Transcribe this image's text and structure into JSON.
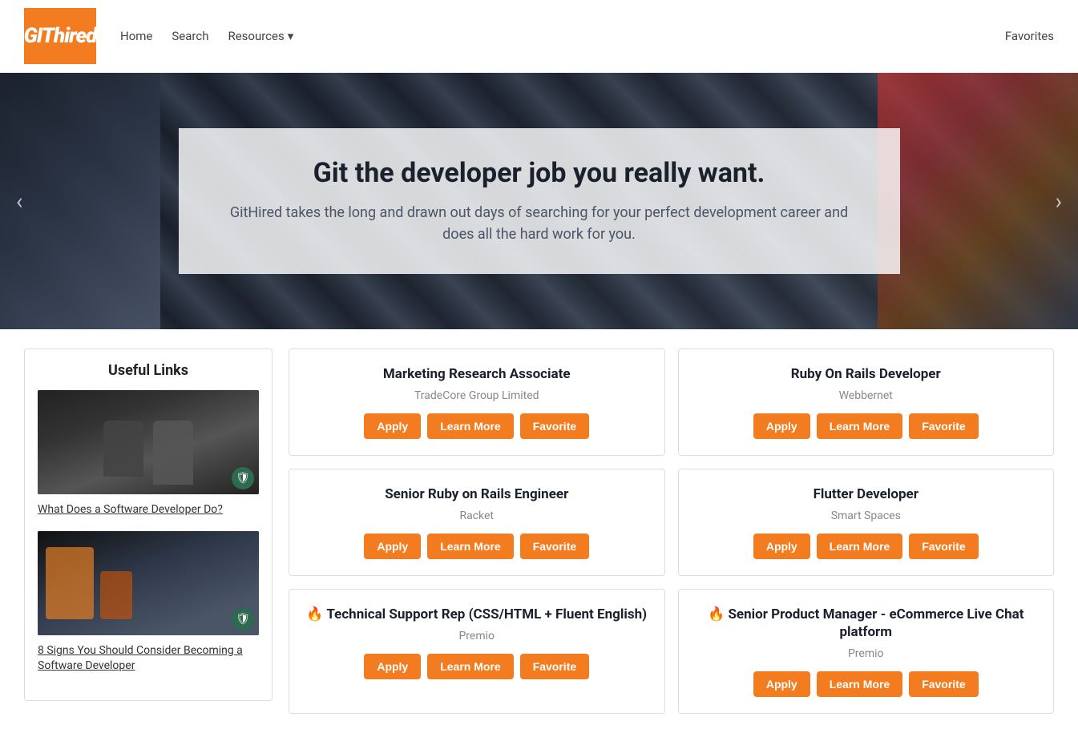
{
  "brand": {
    "logo_git": "GIT",
    "logo_hired": "hired",
    "full_name": "GITHired"
  },
  "navbar": {
    "home_label": "Home",
    "search_label": "Search",
    "resources_label": "Resources",
    "resources_arrow": "▾",
    "favorites_label": "Favorites"
  },
  "hero": {
    "title": "Git the developer job you really want.",
    "subtitle": "GitHired takes the long and drawn out days of searching for your perfect development career and does all the hard work for you.",
    "prev_arrow": "‹",
    "next_arrow": "›"
  },
  "sidebar": {
    "title": "Useful Links",
    "items": [
      {
        "image_alt": "Developer at work",
        "badge": "🛡",
        "link_text": "What Does a Software Developer Do?"
      },
      {
        "image_alt": "Coder at monitor",
        "badge": "🛡",
        "link_text": "8 Signs You Should Consider Becoming a Software Developer"
      }
    ]
  },
  "jobs": [
    {
      "id": 1,
      "title": "Marketing Research Associate",
      "company": "TradeCore Group Limited",
      "hot": false,
      "apply_label": "Apply",
      "learn_more_label": "Learn More",
      "favorite_label": "Favorite"
    },
    {
      "id": 2,
      "title": "Ruby On Rails Developer",
      "company": "Webbernet",
      "hot": false,
      "apply_label": "Apply",
      "learn_more_label": "Learn More",
      "favorite_label": "Favorite"
    },
    {
      "id": 3,
      "title": "Senior Ruby on Rails Engineer",
      "company": "Racket",
      "hot": false,
      "apply_label": "Apply",
      "learn_more_label": "Learn More",
      "favorite_label": "Favorite"
    },
    {
      "id": 4,
      "title": "Flutter Developer",
      "company": "Smart Spaces",
      "hot": false,
      "apply_label": "Apply",
      "learn_more_label": "Learn More",
      "favorite_label": "Favorite"
    },
    {
      "id": 5,
      "title": "Technical Support Rep (CSS/HTML + Fluent English)",
      "company": "Premio",
      "hot": true,
      "hot_icon": "🔥",
      "apply_label": "Apply",
      "learn_more_label": "Learn More",
      "favorite_label": "Favorite"
    },
    {
      "id": 6,
      "title": "Senior Product Manager - eCommerce Live Chat platform",
      "company": "Premio",
      "hot": true,
      "hot_icon": "🔥",
      "apply_label": "Apply",
      "learn_more_label": "Learn More",
      "favorite_label": "Favorite"
    }
  ],
  "colors": {
    "orange": "#f47c20",
    "dark": "#1a202c",
    "gray": "#888"
  }
}
